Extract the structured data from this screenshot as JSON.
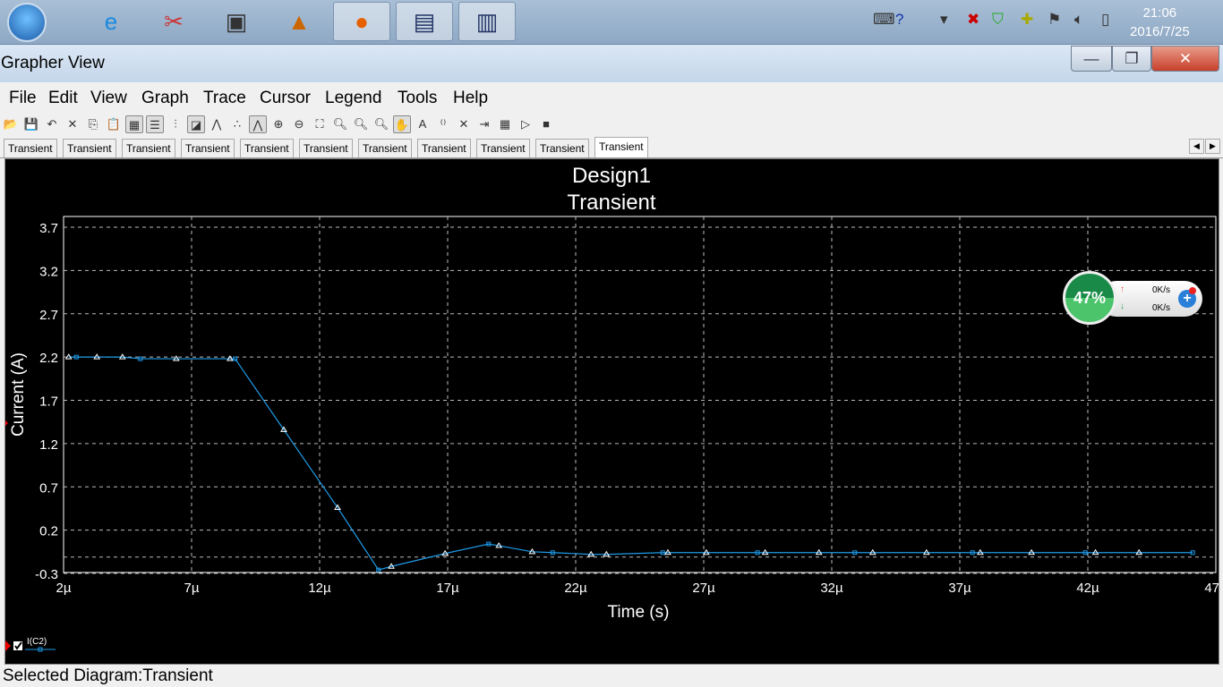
{
  "taskbar": {
    "apps": [
      "windows-start",
      "internet-explorer",
      "snipping-tool",
      "chip-app",
      "matlab",
      "firefox",
      "circuit-app",
      "pcb-app"
    ],
    "clock_time": "21:06",
    "clock_date": "2016/7/25"
  },
  "window": {
    "title": "Grapher View",
    "minimize": "—",
    "restore": "❐",
    "close": "✕"
  },
  "menu": [
    "File",
    "Edit",
    "View",
    "Graph",
    "Trace",
    "Cursor",
    "Legend",
    "Tools",
    "Help"
  ],
  "tabs": [
    "Transient",
    "Transient",
    "Transient",
    "Transient",
    "Transient",
    "Transient",
    "Transient",
    "Transient",
    "Transient",
    "Transient",
    "Transient"
  ],
  "status": "Selected Diagram:Transient",
  "net_widget": {
    "percent": "47%",
    "up": "0K/s",
    "down": "0K/s"
  },
  "chart_data": {
    "type": "line",
    "title": "Design1",
    "subtitle": "Transient",
    "xlabel": "Time (s)",
    "ylabel": "Current (A)",
    "xlim": [
      2,
      47
    ],
    "ylim": [
      -0.3,
      3.7
    ],
    "xticks": [
      "2µ",
      "7µ",
      "12µ",
      "17µ",
      "22µ",
      "27µ",
      "32µ",
      "37µ",
      "42µ",
      "47µ"
    ],
    "yticks": [
      "3.7",
      "3.2",
      "2.7",
      "2.2",
      "1.7",
      "1.2",
      "0.7",
      "0.2",
      "-0.3"
    ],
    "grid": true,
    "legend": {
      "placement": "bottom-left",
      "entries": [
        "I(C2)"
      ]
    },
    "series": [
      {
        "name": "I(C2)",
        "color": "#1e9be8",
        "x": [
          2.2,
          2.5,
          3.3,
          4.3,
          5.0,
          6.4,
          8.5,
          8.7,
          10.6,
          12.7,
          14.3,
          14.8,
          16.9,
          18.6,
          19.0,
          20.3,
          21.1,
          22.6,
          23.2,
          25.4,
          25.6,
          27.1,
          29.1,
          29.4,
          31.5,
          32.9,
          33.6,
          35.7,
          37.5,
          37.8,
          39.8,
          41.9,
          42.3,
          44.0,
          46.1
        ],
        "y": [
          2.2,
          2.2,
          2.2,
          2.2,
          2.18,
          2.18,
          2.18,
          2.18,
          1.36,
          0.46,
          -0.26,
          -0.22,
          -0.07,
          0.04,
          0.02,
          -0.05,
          -0.06,
          -0.08,
          -0.08,
          -0.06,
          -0.06,
          -0.06,
          -0.06,
          -0.06,
          -0.06,
          -0.06,
          -0.06,
          -0.06,
          -0.06,
          -0.06,
          -0.06,
          -0.06,
          -0.06,
          -0.06,
          -0.06
        ]
      }
    ]
  }
}
